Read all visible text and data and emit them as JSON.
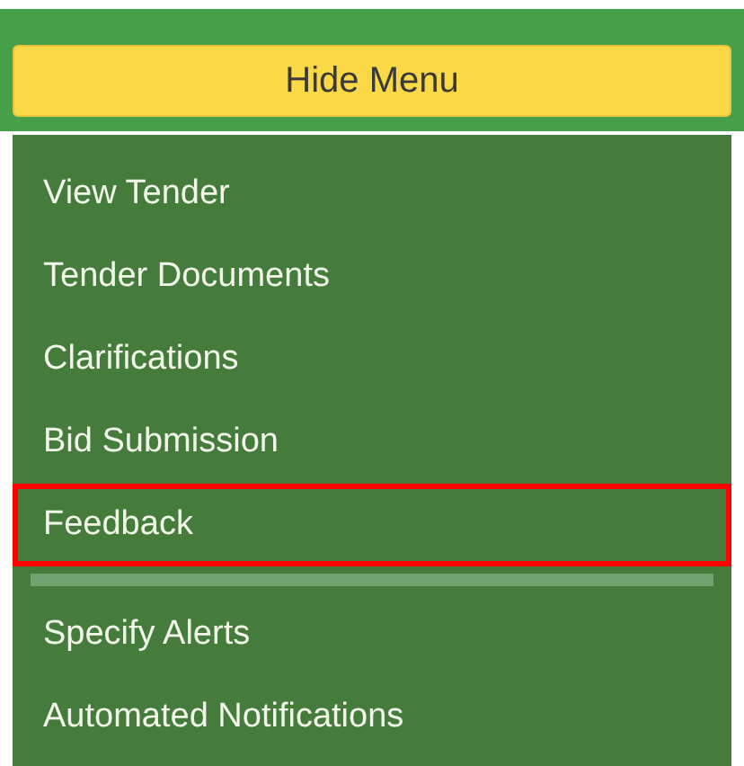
{
  "menu_toggle": {
    "label": "Hide Menu"
  },
  "menu": {
    "items": [
      {
        "kind": "link",
        "label": "View Tender",
        "highlighted": false
      },
      {
        "kind": "link",
        "label": "Tender Documents",
        "highlighted": false
      },
      {
        "kind": "link",
        "label": "Clarifications",
        "highlighted": false
      },
      {
        "kind": "link",
        "label": "Bid Submission",
        "highlighted": false
      },
      {
        "kind": "link",
        "label": "Feedback",
        "highlighted": true
      },
      {
        "kind": "divider"
      },
      {
        "kind": "link",
        "label": "Specify Alerts",
        "highlighted": false
      },
      {
        "kind": "link",
        "label": "Automated Notifications",
        "highlighted": false
      }
    ]
  }
}
